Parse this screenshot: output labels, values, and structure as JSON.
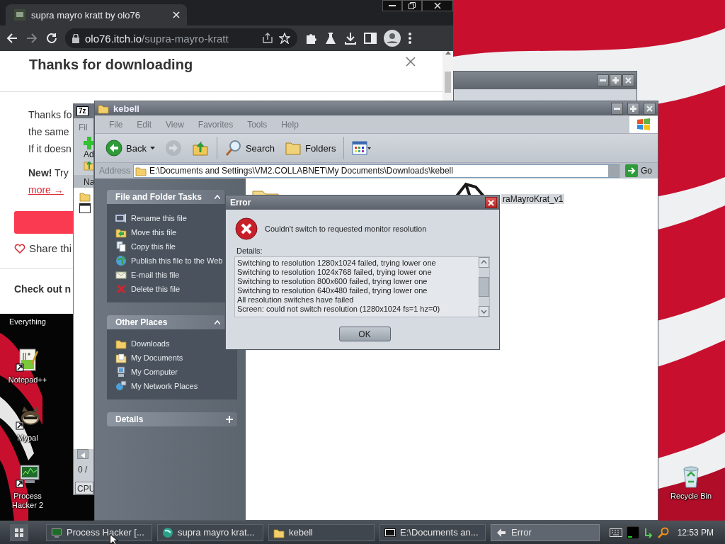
{
  "browser": {
    "tab_title": "supra mayro kratt by olo76",
    "url_host": "olo76.itch.io",
    "url_path": "/supra-mayro-kratt",
    "page": {
      "heading": "Thanks for downloading",
      "lines": [
        "Thanks fo",
        "the same",
        "If it doesn"
      ],
      "promo": "**New!** Try",
      "link": "more →",
      "share": "Share thi",
      "section_heading": "Check out n"
    }
  },
  "archiver": {
    "icon_text": "7z",
    "menu": "Fil",
    "tool": "Ad",
    "column": "Na",
    "status": "0 /",
    "meter": "CPU"
  },
  "explorer": {
    "title": "kebell",
    "menu": [
      {
        "label": "File",
        "disabled": true
      },
      {
        "label": "Edit",
        "disabled": true
      },
      {
        "label": "View",
        "disabled": true
      },
      {
        "label": "Favorites",
        "disabled": true
      },
      {
        "label": "Tools",
        "disabled": true
      },
      {
        "label": "Help",
        "disabled": true
      }
    ],
    "toolbar": [
      {
        "kind": "back",
        "label": "Back",
        "disabled": false
      },
      {
        "kind": "forward",
        "disabled": true
      },
      {
        "kind": "up",
        "disabled": false
      },
      {
        "kind": "search",
        "label": "Search",
        "disabled": false
      },
      {
        "kind": "folders",
        "label": "Folders",
        "disabled": false
      },
      {
        "kind": "views",
        "disabled": false
      }
    ],
    "address_label": "Address",
    "address": "E:\\Documents and Settings\\VM2.COLLABNET\\My Documents\\Downloads\\kebell",
    "go": "Go",
    "panels": [
      {
        "title": "File and Folder Tasks",
        "expanded": true,
        "items": [
          {
            "kind": "rename",
            "label": "Rename this file"
          },
          {
            "kind": "move",
            "label": "Move this file"
          },
          {
            "kind": "copy",
            "label": "Copy this file"
          },
          {
            "kind": "publish",
            "label": "Publish this file to the Web"
          },
          {
            "kind": "email",
            "label": "E-mail this file"
          },
          {
            "kind": "delete",
            "label": "Delete this file"
          }
        ]
      },
      {
        "title": "Other Places",
        "expanded": true,
        "items": [
          {
            "kind": "downloads",
            "label": "Downloads"
          },
          {
            "kind": "documents",
            "label": "My Documents"
          },
          {
            "kind": "computer",
            "label": "My Computer"
          },
          {
            "kind": "network",
            "label": "My Network Places"
          }
        ]
      },
      {
        "title": "Details",
        "expanded": false
      }
    ],
    "files": [
      {
        "kind": "folder"
      },
      {
        "kind": "file",
        "name": "raMayroKrat_v1"
      }
    ]
  },
  "dialog": {
    "title": "Error",
    "message": "Couldn't switch to requested monitor resolution",
    "details_label": "Details:",
    "details": [
      "Switching to resolution 1280x1024 failed, trying lower one",
      "Switching to resolution 1024x768 failed, trying lower one",
      "Switching to resolution 800x600 failed, trying lower one",
      "Switching to resolution 640x480 failed, trying lower one",
      "All resolution switches have failed",
      "Screen: could not switch resolution (1280x1024 fs=1 hz=0)"
    ],
    "button": "OK"
  },
  "desktop_icons": [
    {
      "kind": "everything",
      "label": "Everything"
    },
    {
      "kind": "notepad",
      "label": "Notepad++"
    },
    {
      "kind": "mypal",
      "label": "Mypal"
    },
    {
      "kind": "processhacker",
      "label": "Process Hacker 2"
    },
    {
      "kind": "recycle",
      "label": "Recycle Bin"
    }
  ],
  "taskbar": {
    "tasks": [
      {
        "kind": "processhacker",
        "label": "Process Hacker [...",
        "selected": false
      },
      {
        "kind": "browser",
        "label": "supra mayro krat...",
        "selected": false
      },
      {
        "kind": "folder",
        "label": "kebell",
        "selected": false
      },
      {
        "kind": "archiver",
        "label": "E:\\Documents an...",
        "selected": false
      },
      {
        "kind": "error",
        "label": "Error",
        "selected": true
      }
    ],
    "clock": "12:53 PM"
  }
}
